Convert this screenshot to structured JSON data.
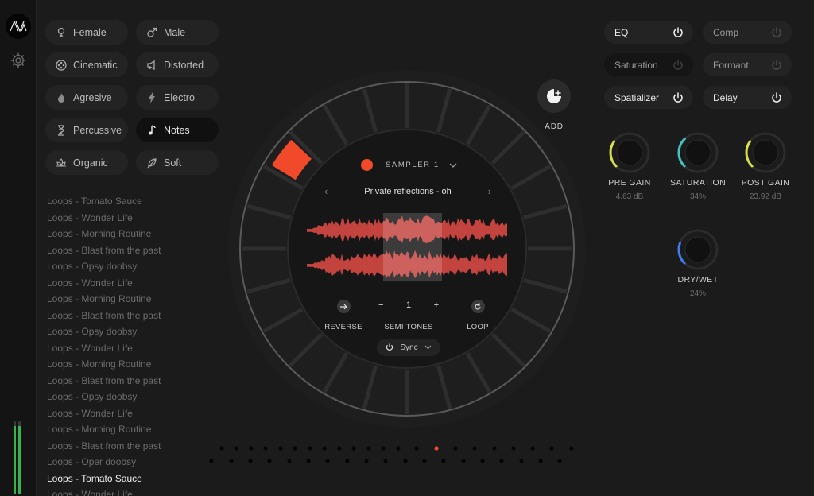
{
  "app": {
    "logo_text": "AVA"
  },
  "tags": [
    {
      "label": "Female",
      "icon": "female-icon",
      "active": false
    },
    {
      "label": "Male",
      "icon": "male-icon",
      "active": false
    },
    {
      "label": "Cinematic",
      "icon": "film-reel-icon",
      "active": false
    },
    {
      "label": "Distorted",
      "icon": "megaphone-icon",
      "active": false
    },
    {
      "label": "Agresive",
      "icon": "flame-icon",
      "active": false
    },
    {
      "label": "Electro",
      "icon": "lightning-icon",
      "active": false
    },
    {
      "label": "Percussive",
      "icon": "hourglass-icon",
      "active": false
    },
    {
      "label": "Notes",
      "icon": "music-note-icon",
      "active": true
    },
    {
      "label": "Organic",
      "icon": "lotus-icon",
      "active": false
    },
    {
      "label": "Soft",
      "icon": "feather-icon",
      "active": false
    }
  ],
  "loops": [
    "Loops - Tomato Sauce",
    "Loops - Wonder Life",
    "Loops - Morning Routine",
    "Loops - Blast from the past",
    "Loops - Opsy doobsy",
    "Loops - Wonder Life",
    "Loops - Morning Routine",
    "Loops - Blast from the past",
    "Loops - Opsy doobsy",
    "Loops - Wonder Life",
    "Loops - Morning Routine",
    "Loops - Blast from the past",
    "Loops - Opsy doobsy",
    "Loops - Wonder Life",
    "Loops - Morning Routine",
    "Loops - Blast from the past",
    "Loops - Oper doobsy",
    "Loops - Tomato Sauce",
    "Loops - Wonder Life"
  ],
  "current_loop_index": 17,
  "sampler": {
    "name": "SAMPLER 1",
    "sample": "Private reflections - oh",
    "reverse_label": "REVERSE",
    "semitones_label": "SEMI TONES",
    "semitones_value": "1",
    "minus": "−",
    "plus": "+",
    "loop_label": "LOOP",
    "sync_label": "Sync",
    "prev": "‹",
    "next": "›"
  },
  "add": {
    "label": "ADD"
  },
  "effects": [
    {
      "label": "EQ",
      "on": true
    },
    {
      "label": "Comp",
      "on": false
    },
    {
      "label": "Saturation",
      "on": false
    },
    {
      "label": "Formant",
      "on": false
    },
    {
      "label": "Spatializer",
      "on": true
    },
    {
      "label": "Delay",
      "on": true
    }
  ],
  "knobs": [
    {
      "label": "PRE GAIN",
      "value": "4.63 dB",
      "color": "#d9e04a",
      "level": 0.3
    },
    {
      "label": "SATURATION",
      "value": "34%",
      "color": "#3fc4c0",
      "level": 0.34
    },
    {
      "label": "POST GAIN",
      "value": "23.92 dB",
      "color": "#d9e04a",
      "level": 0.3
    },
    {
      "label": "DRY/WET",
      "value": "24%",
      "color": "#3d7df0",
      "level": 0.24
    }
  ],
  "colors": {
    "accent": "#f04a2a",
    "waveform": "#e24b47",
    "panel": "#232324"
  }
}
